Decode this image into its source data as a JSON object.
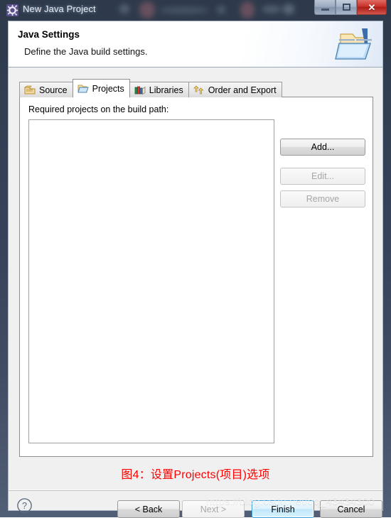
{
  "window": {
    "title": "New Java Project",
    "icon": "java-project-gear-icon",
    "controls": {
      "minimize": "Minimize",
      "maximize": "Maximize",
      "close": "Close",
      "close_glyph": "✕"
    }
  },
  "header": {
    "title": "Java Settings",
    "subtitle": "Define the Java build settings.",
    "banner_icon": "java-folder-banner-icon"
  },
  "tabs": [
    {
      "label": "Source",
      "icon": "source-package-icon",
      "selected": false
    },
    {
      "label": "Projects",
      "icon": "open-folder-icon",
      "selected": true
    },
    {
      "label": "Libraries",
      "icon": "books-icon",
      "selected": false
    },
    {
      "label": "Order and Export",
      "icon": "order-arrows-icon",
      "selected": false
    }
  ],
  "projects_tab": {
    "list_label": "Required projects on the build path:",
    "list_items": [],
    "buttons": [
      {
        "label": "Add...",
        "enabled": true
      },
      {
        "label": "Edit...",
        "enabled": false
      },
      {
        "label": "Remove",
        "enabled": false
      }
    ]
  },
  "caption": {
    "text": "图4：设置Projects(项目)选项",
    "color": "#fd0000"
  },
  "footer": {
    "help_icon": "help-question-icon",
    "buttons": [
      {
        "label": "< Back",
        "enabled": true,
        "default": false
      },
      {
        "label": "Next >",
        "enabled": false,
        "default": false
      },
      {
        "label": "Finish",
        "enabled": true,
        "default": true
      },
      {
        "label": "Cancel",
        "enabled": true,
        "default": false
      }
    ]
  },
  "watermark": {
    "text": "https://blog.csdn.net/qq_43434300"
  }
}
